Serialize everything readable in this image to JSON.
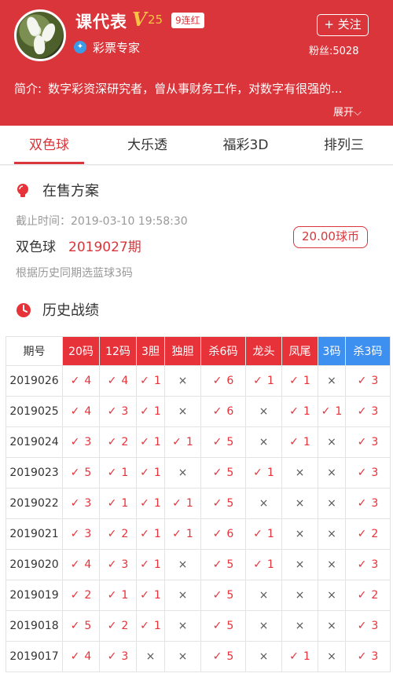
{
  "profile": {
    "name": "课代表",
    "vip_letter": "V",
    "vip_level": "25",
    "streak": "9连红",
    "expert_label": "彩票专家",
    "follow_label": "+ 关注",
    "fans": "粉丝:5028",
    "intro_label": "简介:",
    "intro_text": "数字彩资深研究者，曾从事财务工作，对数字有很强的...",
    "expand_label": "展开⌵"
  },
  "tabs": [
    "双色球",
    "大乐透",
    "福彩3D",
    "排列三"
  ],
  "sale": {
    "title": "在售方案",
    "deadline": "截止时间：2019-03-10 19:58:30",
    "game": "双色球",
    "issue": "2019027期",
    "price": "20.00球币",
    "desc": "根据历史同期选蓝球3码"
  },
  "history": {
    "title": "历史战绩",
    "headers": [
      "期号",
      "20码",
      "12码",
      "3胆",
      "独胆",
      "杀6码",
      "龙头",
      "凤尾",
      "3码",
      "杀3码"
    ],
    "header_colors": {
      "red": "#e8323a",
      "blue": "#3d8ff0"
    },
    "rows": [
      [
        "2019026",
        "4",
        "4",
        "1",
        "×",
        "6",
        "1",
        "1",
        "×",
        "3"
      ],
      [
        "2019025",
        "4",
        "3",
        "1",
        "×",
        "6",
        "×",
        "1",
        "1",
        "3"
      ],
      [
        "2019024",
        "3",
        "2",
        "1",
        "1",
        "5",
        "×",
        "1",
        "×",
        "3"
      ],
      [
        "2019023",
        "5",
        "1",
        "1",
        "×",
        "5",
        "1",
        "×",
        "×",
        "3"
      ],
      [
        "2019022",
        "3",
        "1",
        "1",
        "1",
        "5",
        "×",
        "×",
        "×",
        "3"
      ],
      [
        "2019021",
        "3",
        "2",
        "1",
        "1",
        "6",
        "1",
        "×",
        "×",
        "2"
      ],
      [
        "2019020",
        "4",
        "3",
        "1",
        "×",
        "5",
        "1",
        "×",
        "×",
        "3"
      ],
      [
        "2019019",
        "2",
        "1",
        "1",
        "×",
        "5",
        "×",
        "×",
        "×",
        "2"
      ],
      [
        "2019018",
        "5",
        "2",
        "1",
        "×",
        "5",
        "×",
        "×",
        "×",
        "3"
      ],
      [
        "2019017",
        "4",
        "3",
        "×",
        "×",
        "5",
        "×",
        "1",
        "×",
        "3"
      ]
    ],
    "check_symbol": "✓"
  }
}
